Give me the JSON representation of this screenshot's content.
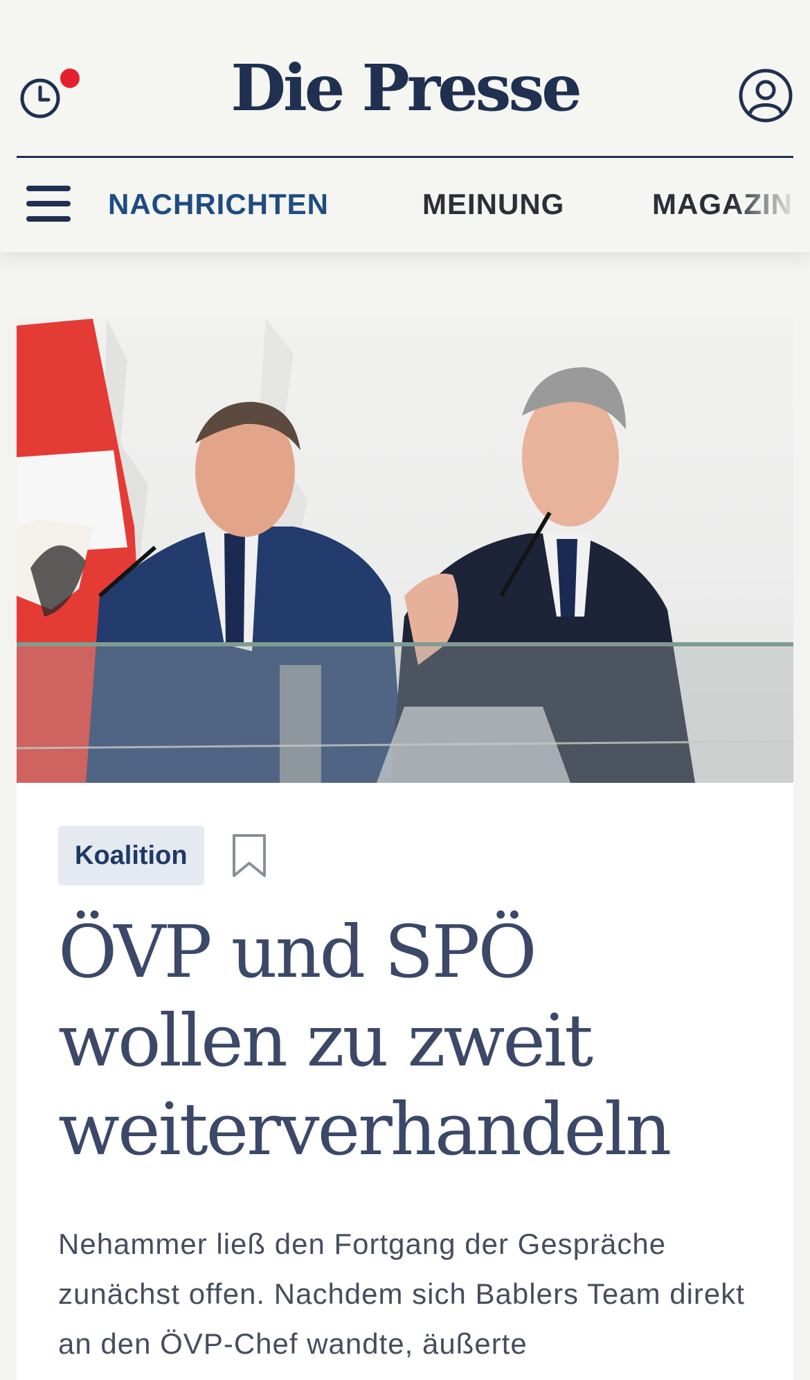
{
  "header": {
    "logo": "Die Presse",
    "nav": {
      "items": [
        {
          "label": "NACHRICHTEN",
          "active": true
        },
        {
          "label": "MEINUNG",
          "active": false
        },
        {
          "label": "MAGAZIN",
          "active": false
        }
      ]
    },
    "icons": {
      "history": "history-clock-icon",
      "notification": "notification-dot",
      "account": "user-account-icon",
      "menu": "hamburger-menu-icon"
    }
  },
  "article": {
    "tag": "Koalition",
    "bookmark_icon": "bookmark-icon",
    "headline": "ÖVP und SPÖ wollen zu zweit weiterverhandeln",
    "lead": "Nehammer ließ den Fortgang der Gespräche zunächst offen. Nachdem sich Bablers Team direkt an den ÖVP-Chef wandte, äußerte"
  },
  "colors": {
    "brand": "#1f3050",
    "nav_active": "#1d4c80",
    "notification": "#e5202e",
    "tag_bg": "#e5eaf1",
    "headline": "#3b4868"
  }
}
